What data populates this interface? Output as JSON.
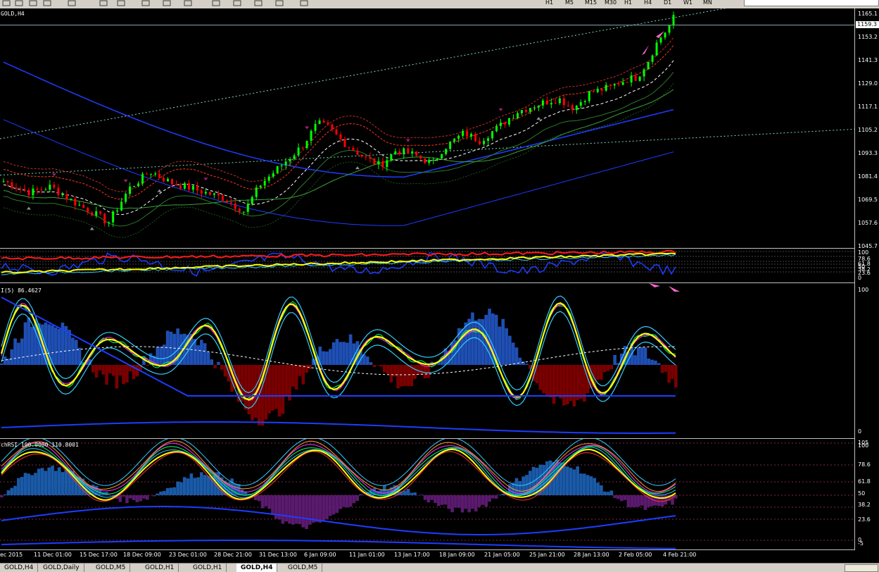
{
  "toolbar": {
    "icons": [
      "new-chart-icon",
      "profiles-icon",
      "open-icon",
      "crosshair-icon",
      "zoom-in-icon",
      "zoom-out-icon",
      "tile-icon",
      "scroll-icon",
      "shift-icon",
      "indicators-icon",
      "clock-icon",
      "template-icon",
      "cursor-icon",
      "trendline-icon",
      "text-icon"
    ],
    "timeframes": [
      "H1",
      "M5",
      "M15",
      "M30",
      "H1",
      "H4",
      "D1",
      "W1",
      "MN"
    ]
  },
  "chart": {
    "symbol_title": "GOLD,H4",
    "current_price": "1159.3",
    "price_axis": [
      "1165.1",
      "1153.2",
      "1141.3",
      "1129.0",
      "1117.1",
      "1105.2",
      "1093.3",
      "1081.4",
      "1069.5",
      "1057.6",
      "1045.7"
    ],
    "time_axis": [
      "ec 2015",
      "11 Dec 01:00",
      "15 Dec 17:00",
      "18 Dec 09:00",
      "23 Dec 01:00",
      "28 Dec 21:00",
      "31 Dec 13:00",
      "6 Jan 09:00",
      "11 Jan 01:00",
      "13 Jan 17:00",
      "18 Jan 09:00",
      "21 Jan 05:00",
      "25 Jan 21:00",
      "28 Jan 13:00",
      "2 Feb 05:00",
      "4 Feb 21:00"
    ]
  },
  "indicator1": {
    "axis": [
      "100",
      "78.6",
      "61.8",
      "50",
      "38.2",
      "23.6",
      "0"
    ]
  },
  "indicator2": {
    "label": "I(5) 86.4627",
    "axis": [
      "100",
      "0"
    ]
  },
  "indicator3": {
    "label": "chRSI 100.0000 110.8001",
    "axis": [
      "105",
      "100",
      "78.6",
      "61.8",
      "50",
      "38.2",
      "23.6",
      "0",
      "-5"
    ]
  },
  "tabs": [
    "GOLD,H4",
    "GOLD,Daily",
    "GOLD,M5",
    "GOLD,H1",
    "GOLD,H1",
    "GOLD,H4",
    "GOLD,M5"
  ],
  "active_tab_index": 5,
  "colors": {
    "bull": "#00ff00",
    "bear": "#ff0000",
    "ma_blue": "#1e3cff",
    "stoch_yellow": "#ffff00",
    "stoch_cyan": "#33ccff",
    "hist_blue": "#1f4fb4",
    "hist_red": "#7a0000",
    "hist_purple": "#5a1a6e"
  }
}
